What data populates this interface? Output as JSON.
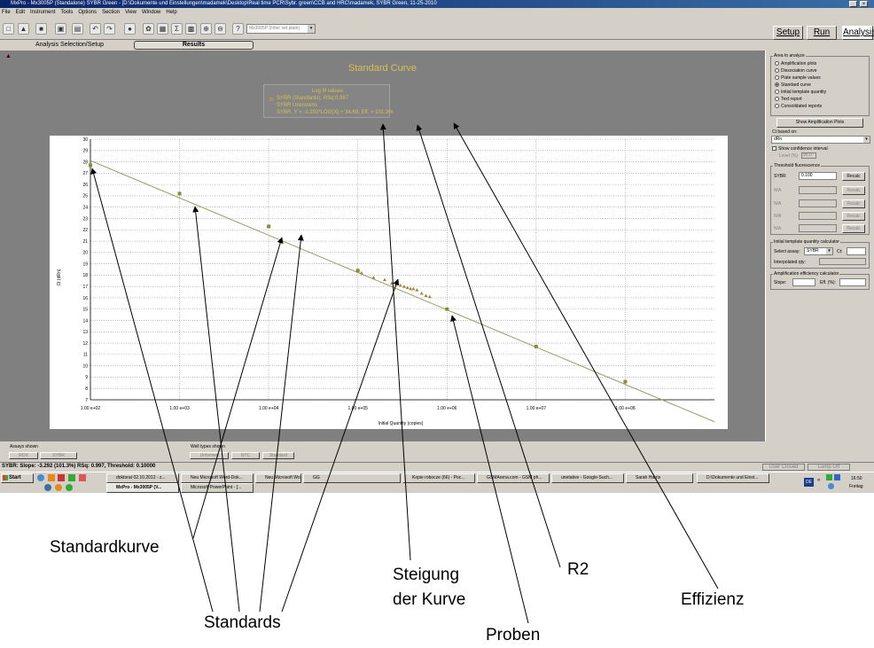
{
  "window": {
    "title": "MxPro - Mx3005P (Standalone) SYBR Green - [D:\\Dokumente und Einstellungen\\madamek\\Desktop\\Real time PCR\\Sybr. green\\CCB and HRC\\madamek, SYBR Green, 11-25-2010",
    "controls": [
      "_",
      "×"
    ]
  },
  "menu": [
    "File",
    "Edit",
    "Instrument",
    "Tools",
    "Options",
    "Section",
    "View",
    "Window",
    "Help"
  ],
  "toolbar": {
    "instrument_select": "Mx3005P (Filter set plate)",
    "setup_label": "Setup",
    "run_label": "Run",
    "analysis_label": "Analysis"
  },
  "tabs": {
    "selection": "Analysis Selection/Setup",
    "results": "Results"
  },
  "chart_panel": {
    "title": "Standard Curve",
    "legend": {
      "heading": "Log fit values",
      "line1": "SYBR (Standards), RSq:0.997",
      "line2": "SYBR Unknowns",
      "line3": "SYBR, Y = -3.292*LOG(X) + 34.69, Eff. = 101.3%"
    }
  },
  "chart_data": {
    "type": "scatter",
    "xlabel": "Initial Quantity (copies)",
    "ylabel": "Ct (dRn)",
    "xscale": "log",
    "xlim": [
      100,
      1000000000
    ],
    "ylim": [
      7,
      30
    ],
    "x_ticks": [
      "1.00 e+02",
      "1.00 e+03",
      "1.00 e+04",
      "1.00 e+05",
      "1.00 e+06",
      "1.00 e+07",
      "1.00 e+08"
    ],
    "y_ticks": [
      "7",
      "8",
      "9",
      "10",
      "11",
      "12",
      "13",
      "14",
      "15",
      "16",
      "17",
      "18",
      "19",
      "20",
      "21",
      "22",
      "23",
      "24",
      "25",
      "26",
      "27",
      "28",
      "29",
      "30"
    ],
    "fit": {
      "slope": -3.292,
      "intercept": 34.69,
      "efficiency": 101.3,
      "rsq": 0.997
    },
    "grid": true,
    "series": [
      {
        "name": "SYBR (Standards)",
        "color": "#8a8a3a",
        "x": [
          100,
          1000,
          10000,
          100000,
          1000000,
          10000000,
          100000000
        ],
        "y": [
          27.7,
          25.2,
          22.3,
          18.4,
          15.0,
          11.7,
          8.6
        ]
      },
      {
        "name": "SYBR Unknowns",
        "color": "#9a8a3a",
        "x": [
          110000,
          150000,
          200000,
          240000,
          270000,
          300000,
          330000,
          360000,
          390000,
          420000,
          460000,
          520000,
          580000,
          640000
        ],
        "y": [
          18.2,
          17.8,
          17.6,
          17.3,
          17.2,
          17.1,
          17.0,
          16.9,
          16.8,
          16.8,
          16.7,
          16.4,
          16.2,
          16.1
        ]
      }
    ]
  },
  "right_panel": {
    "area_label": "Area to analyze",
    "options": [
      "Amplification plots",
      "Dissociation curve",
      "Plate sample values",
      "Standard curve",
      "Initial template quantity",
      "Text report",
      "Consolidated reports"
    ],
    "selected": "Standard curve",
    "show_plots_button": "Show Amplification Plots",
    "ct_based_label": "Ct based on:",
    "ct_based_value": "dRn",
    "confidence_label": "Show confidence interval",
    "level_label": "Level (%)",
    "level_value": "95.0",
    "threshold_label": "Threshold fluorescence",
    "threshold_rows": [
      {
        "name": "SYBR",
        "value": "0.100",
        "button": "Recalc"
      },
      {
        "name": "N/A",
        "value": "",
        "button": "Recalc"
      },
      {
        "name": "N/A",
        "value": "",
        "button": "Recalc"
      },
      {
        "name": "N/A",
        "value": "",
        "button": "Recalc"
      },
      {
        "name": "N/A",
        "value": "",
        "button": "Recalc"
      }
    ],
    "itq_label": "Initial template quantity calculator",
    "select_assay_label": "Select assay:",
    "select_assay_value": "SYBR",
    "ct_label": "Ct:",
    "interpolated_label": "Interpolated qty:",
    "eff_calc_label": "Amplification efficiency calculator",
    "slope_label": "Slope:",
    "eff_label": "Eff. (%):"
  },
  "bottom": {
    "assays_label": "Assays shown",
    "assays": [
      "ROX",
      "SYBR"
    ],
    "well_types_label": "Well types shown",
    "well_types": [
      "Unknown",
      "NTC",
      "Standard"
    ],
    "status_line": "SYBR: Slope: -3.292 (101.3%) RSq: 0.997, Threshold: 0.10000",
    "user_closed": "User Closed",
    "lamp_off": "Lamp Off"
  },
  "taskbar": {
    "start": "Start",
    "tasks_row1": [
      "doktorat 02.10.2012 - z...",
      "Neu Microsoft Word-Dok...",
      "Neu Microsoft Word-Dok...",
      "GG",
      "Kopie robocze (66) - Poc...",
      "GSMArena.com - GSM ph...",
      "unetative - Google-Such...",
      "Sarah Harris",
      "D:\\Dokumente und Einst..."
    ],
    "tasks_row2": [
      "MxPro - Mx3005P (V...",
      "Microsoft PowerPoint - [..."
    ],
    "clock": "16:50",
    "day": "Freitag",
    "lang": "DE"
  },
  "annotations": {
    "standardkurve": "Standardkurve",
    "standards": "Standards",
    "steigung_1": "Steigung",
    "steigung_2": "der Kurve",
    "r2": "R2",
    "proben": "Proben",
    "effizienz": "Effizienz"
  }
}
